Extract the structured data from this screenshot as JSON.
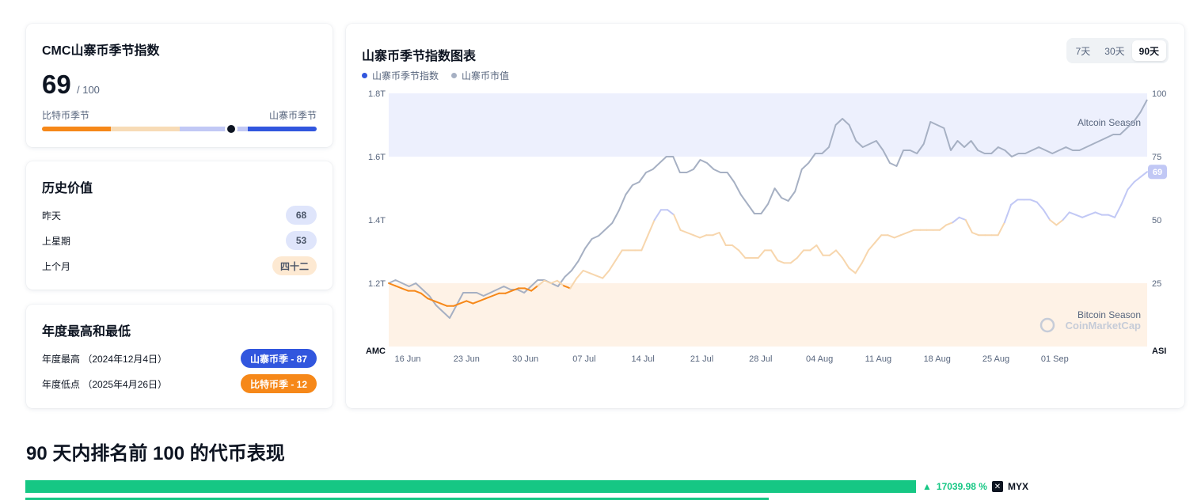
{
  "index_card": {
    "title": "CMC山寨币季节指数",
    "value": "69",
    "denominator": "/ 100",
    "left_label": "比特币季节",
    "right_label": "山寨币季节",
    "level": 0.69,
    "colors": {
      "bitcoin": "#f68819",
      "bitcoin_light": "#f7dbb6",
      "mid": "#c1c8f5",
      "altcoin": "#3156de"
    }
  },
  "history": {
    "title": "历史价值",
    "rows": [
      {
        "label": "昨天",
        "value": "68",
        "bg": "#dfe5fb",
        "fg": "#4a5568"
      },
      {
        "label": "上星期",
        "value": "53",
        "bg": "#dfe5fb",
        "fg": "#4a5568"
      },
      {
        "label": "上个月",
        "value": "四十二",
        "bg": "#fde9d2",
        "fg": "#4a5568"
      }
    ]
  },
  "yearly": {
    "title": "年度最高和最低",
    "high_label": "年度最高 （2024年12月4日）",
    "high_value": "山寨币季 - 87",
    "low_label": "年度低点 （2025年4月26日）",
    "low_value": "比特币季 - 12"
  },
  "chart": {
    "title": "山寨币季节指数图表",
    "legend": [
      {
        "name": "山寨币季节指数",
        "color": "#3156de"
      },
      {
        "name": "山寨币市值",
        "color": "#a6b0c3"
      }
    ],
    "tabs": [
      "7天",
      "30天",
      "90天"
    ],
    "active_tab": "90天",
    "left_axis_title": "AMC",
    "right_axis_title": "ASI",
    "altcoin_zone_label": "Altcoin Season",
    "bitcoin_zone_label": "Bitcoin Season",
    "watermark": "CoinMarketCap",
    "current_badge": "69"
  },
  "chart_data": {
    "type": "line",
    "x_labels": [
      "16 Jun",
      "23 Jun",
      "30 Jun",
      "07 Jul",
      "14 Jul",
      "21 Jul",
      "28 Jul",
      "04 Aug",
      "11 Aug",
      "18 Aug",
      "25 Aug",
      "01 Sep"
    ],
    "y_left_ticks": [
      "1.8T",
      "1.6T",
      "1.4T",
      "1.2T"
    ],
    "y_right_ticks": [
      "100",
      "75",
      "50",
      "25"
    ],
    "ylim_left": [
      1.0,
      1.8
    ],
    "ylim_right": [
      0,
      100
    ],
    "series": [
      {
        "name": "山寨币季节指数",
        "axis": "right",
        "values": [
          25,
          24,
          23,
          22,
          22,
          21,
          19,
          18,
          17,
          16,
          16,
          17,
          18,
          17,
          18,
          19,
          20,
          21,
          21,
          22,
          23,
          23,
          22,
          24,
          26,
          25,
          26,
          24,
          23,
          27,
          30,
          29,
          28,
          27,
          30,
          34,
          38,
          38,
          38,
          38,
          44,
          50,
          54,
          54,
          52,
          46,
          45,
          44,
          43,
          44,
          44,
          45,
          40,
          40,
          38,
          35,
          35,
          35,
          38,
          38,
          34,
          33,
          33,
          35,
          38,
          38,
          40,
          36,
          36,
          38,
          35,
          31,
          29,
          33,
          38,
          41,
          44,
          44,
          43,
          44,
          45,
          46,
          46,
          46,
          46,
          46,
          48,
          49,
          51,
          50,
          45,
          44,
          44,
          44,
          44,
          49,
          56,
          58,
          58,
          58,
          57,
          54,
          50,
          48,
          50,
          53,
          52,
          51,
          52,
          53,
          52,
          52,
          51,
          56,
          62,
          65,
          67,
          69
        ]
      },
      {
        "name": "山寨币市值",
        "axis": "left",
        "values": [
          1.2,
          1.21,
          1.2,
          1.19,
          1.2,
          1.18,
          1.16,
          1.13,
          1.11,
          1.09,
          1.13,
          1.17,
          1.17,
          1.17,
          1.16,
          1.17,
          1.18,
          1.19,
          1.18,
          1.18,
          1.17,
          1.19,
          1.21,
          1.21,
          1.2,
          1.19,
          1.22,
          1.24,
          1.27,
          1.31,
          1.34,
          1.35,
          1.37,
          1.39,
          1.43,
          1.48,
          1.51,
          1.52,
          1.55,
          1.56,
          1.58,
          1.6,
          1.6,
          1.55,
          1.55,
          1.56,
          1.59,
          1.58,
          1.56,
          1.55,
          1.55,
          1.52,
          1.48,
          1.45,
          1.42,
          1.42,
          1.45,
          1.5,
          1.47,
          1.46,
          1.49,
          1.56,
          1.58,
          1.61,
          1.61,
          1.63,
          1.7,
          1.72,
          1.7,
          1.65,
          1.63,
          1.64,
          1.65,
          1.62,
          1.58,
          1.57,
          1.62,
          1.62,
          1.61,
          1.64,
          1.71,
          1.7,
          1.69,
          1.62,
          1.65,
          1.63,
          1.65,
          1.62,
          1.61,
          1.61,
          1.63,
          1.62,
          1.6,
          1.61,
          1.61,
          1.62,
          1.63,
          1.62,
          1.61,
          1.62,
          1.63,
          1.62,
          1.62,
          1.63,
          1.64,
          1.65,
          1.66,
          1.67,
          1.67,
          1.69,
          1.71,
          1.74,
          1.78
        ]
      }
    ],
    "altcoin_zone": [
      75,
      100
    ],
    "bitcoin_zone": [
      0,
      25
    ],
    "grid": false
  },
  "performance": {
    "title": "90 天内排名前 100 的代币表现",
    "top_pct": "17039.98 %",
    "top_coin": "MYX",
    "top_fraction": 1.0,
    "second_fraction": 0.835
  }
}
